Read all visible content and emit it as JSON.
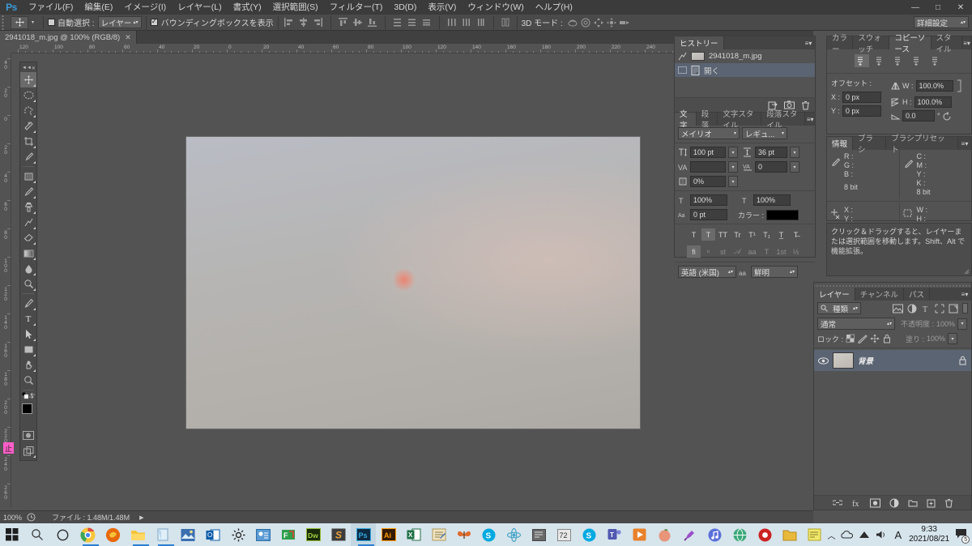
{
  "app": {
    "name": "Photoshop",
    "logo": "Ps"
  },
  "menubar": {
    "items": [
      {
        "label": "ファイル(F)"
      },
      {
        "label": "編集(E)"
      },
      {
        "label": "イメージ(I)"
      },
      {
        "label": "レイヤー(L)"
      },
      {
        "label": "書式(Y)"
      },
      {
        "label": "選択範囲(S)"
      },
      {
        "label": "フィルター(T)"
      },
      {
        "label": "3D(D)"
      },
      {
        "label": "表示(V)"
      },
      {
        "label": "ウィンドウ(W)"
      },
      {
        "label": "ヘルプ(H)"
      }
    ],
    "window_buttons": [
      "―",
      "□",
      "✕"
    ]
  },
  "options_bar": {
    "auto_select_label": "自動選択 :",
    "auto_select_checked": false,
    "layer_dropdown_value": "レイヤー",
    "bounding_box_label": "バウンディングボックスを表示",
    "bounding_box_checked": true,
    "mode_3d_label": "3D モード :",
    "workspace_value": "詳細設定"
  },
  "document": {
    "tab_title": "2941018_m.jpg @ 100% (RGB/8)",
    "close_glyph": "✕"
  },
  "rulers": {
    "h_ticks": [
      "120",
      "100",
      "80",
      "60",
      "40",
      "20",
      "0",
      "20",
      "40",
      "60",
      "80",
      "100",
      "120",
      "140",
      "160",
      "180",
      "200",
      "220",
      "240",
      "260",
      "280",
      "300",
      "320"
    ],
    "v_ticks": [
      "40",
      "20",
      "0",
      "20",
      "40",
      "60",
      "80",
      "100",
      "120",
      "140",
      "160",
      "180",
      "200",
      "220",
      "240",
      "260"
    ]
  },
  "toolbox": {
    "tools": [
      {
        "name": "move-tool",
        "glyph": "✥",
        "active": true
      },
      {
        "name": "elliptical-marquee-tool",
        "glyph": "◯"
      },
      {
        "name": "lasso-tool",
        "glyph": "🔗"
      },
      {
        "name": "magic-wand-tool",
        "glyph": "✦"
      },
      {
        "name": "crop-tool",
        "glyph": "⌗"
      },
      {
        "name": "eyedropper-tool",
        "glyph": "⚲"
      },
      {
        "name": "healing-brush-tool",
        "glyph": "▩"
      },
      {
        "name": "brush-tool",
        "glyph": "✎"
      },
      {
        "name": "clone-stamp-tool",
        "glyph": "⎙"
      },
      {
        "name": "history-brush-tool",
        "glyph": "⌁"
      },
      {
        "name": "eraser-tool",
        "glyph": "▭"
      },
      {
        "name": "gradient-tool",
        "glyph": "▤"
      },
      {
        "name": "blur-tool",
        "glyph": "💧"
      },
      {
        "name": "dodge-tool",
        "glyph": "◍"
      },
      {
        "name": "pen-tool",
        "glyph": "✒"
      },
      {
        "name": "type-tool",
        "glyph": "T"
      },
      {
        "name": "path-selection-tool",
        "glyph": "➤"
      },
      {
        "name": "rectangle-tool",
        "glyph": "▢"
      },
      {
        "name": "hand-tool",
        "glyph": "✋"
      },
      {
        "name": "zoom-tool",
        "glyph": "🔍"
      }
    ],
    "foreground_color": "#000000",
    "background_color": "#ffffff"
  },
  "history_panel": {
    "tabs": [
      {
        "label": "ヒストリー",
        "active": true
      }
    ],
    "rows": [
      {
        "label": "2941018_m.jpg",
        "type": "snapshot",
        "selected": false
      },
      {
        "label": "開く",
        "type": "state",
        "selected": true
      }
    ],
    "footer_icons": [
      "new-document-icon",
      "camera-icon",
      "trash-icon"
    ]
  },
  "character_panel": {
    "tabs": [
      {
        "label": "文字",
        "active": true
      },
      {
        "label": "段落",
        "active": false
      },
      {
        "label": "文字スタイル",
        "active": false
      },
      {
        "label": "段落スタイル",
        "active": false
      }
    ],
    "font_family": "メイリオ",
    "font_style": "レギュ...",
    "font_size": "100 pt",
    "leading": "36 pt",
    "tracking": "",
    "kerning": "0",
    "vertical_scale_pct": "100%",
    "horizontal_scale_pct": "100%",
    "baseline_shift": "0 pt",
    "t_scale_pct": "0%",
    "color_label": "カラー :",
    "color_value": "#000000",
    "style_buttons": [
      "T",
      "T",
      "TT",
      "Tr",
      "T¹",
      "T₁",
      "T̲",
      "T̶"
    ],
    "ot_buttons": [
      "fi",
      "ᵒ",
      "st",
      "𝒜",
      "aa",
      "T",
      "1st",
      "½"
    ],
    "language": "英語 (米国)",
    "antialias": "鮮明"
  },
  "clone_source_panel": {
    "tabs": [
      {
        "label": "カラー",
        "active": false
      },
      {
        "label": "スウォッチ",
        "active": false
      },
      {
        "label": "コピーソース",
        "active": true
      },
      {
        "label": "スタイル",
        "active": false
      }
    ],
    "offset_label": "オフセット :",
    "x_label": "X :",
    "x_value": "0 px",
    "y_label": "Y :",
    "y_value": "0 px",
    "w_label": "W :",
    "w_value": "100.0%",
    "h_label": "H :",
    "h_value": "100.0%",
    "angle_value": "0.0",
    "angle_unit": "°"
  },
  "info_panel": {
    "tabs": [
      {
        "label": "情報",
        "active": true
      },
      {
        "label": "ブラシ",
        "active": false
      },
      {
        "label": "ブラシプリセット",
        "active": false
      }
    ],
    "left_channels": [
      "R :",
      "G :",
      "B :"
    ],
    "left_depth": "8 bit",
    "right_channels": [
      "C :",
      "M :",
      "Y :",
      "K :"
    ],
    "right_depth": "8 bit",
    "coord_labels": [
      "X :",
      "Y :"
    ],
    "size_labels": [
      "W :",
      "H :"
    ],
    "file_label": "ファイル : 1.48M/1.48M",
    "hint_text": "クリック＆ドラッグすると、レイヤーまたは選択範囲を移動します。Shift、Alt で機能拡張。"
  },
  "layers_panel": {
    "tabs": [
      {
        "label": "レイヤー",
        "active": true
      },
      {
        "label": "チャンネル",
        "active": false
      },
      {
        "label": "パス",
        "active": false
      }
    ],
    "filter_label": "種類",
    "blend_mode": "通常",
    "opacity_label": "不透明度 :",
    "opacity_value": "100%",
    "lock_label": "ロック :",
    "fill_label": "塗り :",
    "fill_value": "100%",
    "layers": [
      {
        "name": "背景",
        "visible": true,
        "locked": true
      }
    ]
  },
  "status_bar": {
    "zoom": "100%",
    "file_info": "ファイル : 1.48M/1.48M",
    "arrow": "▶"
  },
  "taskbar": {
    "start_icon": "windows-start-icon",
    "search_icon": "search-icon",
    "cortana_icon": "cortana-icon",
    "apps": [
      {
        "name": "chrome-icon",
        "label": "C",
        "color": "#4285f4",
        "running": true
      },
      {
        "name": "firefox-icon",
        "label": "f",
        "color": "#e8690b",
        "running": false
      },
      {
        "name": "file-explorer-icon",
        "label": "📁",
        "color": "#f5c33b",
        "running": true
      },
      {
        "name": "notepad-icon",
        "label": "📘",
        "color": "#6ec2f0",
        "running": true
      },
      {
        "name": "photos-icon",
        "label": "🖼",
        "color": "#3a6fb0",
        "running": false
      },
      {
        "name": "outlook-icon",
        "label": "O",
        "color": "#0a5ba8",
        "running": false
      },
      {
        "name": "settings-gear-icon",
        "label": "⚙",
        "color": "#3b3b3b",
        "running": false
      },
      {
        "name": "contacts-icon",
        "label": "▤",
        "color": "#5b9bd5",
        "running": false
      },
      {
        "name": "ftp-icon",
        "label": "F",
        "color": "#2e9e4b",
        "running": false
      },
      {
        "name": "dreamweaver-icon",
        "label": "Dw",
        "color": "#6b8f1e",
        "running": false
      },
      {
        "name": "sublime-icon",
        "label": "S",
        "color": "#3d3d3d",
        "running": false
      },
      {
        "name": "photoshop-icon",
        "label": "Ps",
        "color": "#2b5d8a",
        "running": true,
        "current": true
      },
      {
        "name": "illustrator-icon",
        "label": "Ai",
        "color": "#d9802b",
        "running": false
      },
      {
        "name": "excel-icon",
        "label": "X",
        "color": "#1d7044",
        "running": false
      },
      {
        "name": "notes-icon",
        "label": "📝",
        "color": "#e8d8a8",
        "running": false
      },
      {
        "name": "butterfly-icon",
        "label": "🦋",
        "color": "#d8712a",
        "running": false
      },
      {
        "name": "skype-icon",
        "label": "S",
        "color": "#00a9e0",
        "running": false
      },
      {
        "name": "atom-icon",
        "label": "⚛",
        "color": "#4aa6c8",
        "running": false
      },
      {
        "name": "editor-icon",
        "label": "▤",
        "color": "#7a7a7a",
        "running": false
      },
      {
        "name": "calc-icon",
        "label": "72",
        "color": "#444",
        "running": false
      },
      {
        "name": "skype2-icon",
        "label": "S",
        "color": "#00a9e0",
        "running": false
      },
      {
        "name": "teams-icon",
        "label": "T",
        "color": "#5058b0",
        "running": false
      },
      {
        "name": "media-icon",
        "label": "▶",
        "color": "#e8822b",
        "running": false
      },
      {
        "name": "peach-icon",
        "label": "🍑",
        "color": "#e89a7a",
        "running": false
      },
      {
        "name": "paint3d-icon",
        "label": "✎",
        "color": "#9b4fc8",
        "running": false
      },
      {
        "name": "music-icon",
        "label": "♪",
        "color": "#5a6fd8",
        "running": false
      },
      {
        "name": "globe-icon",
        "label": "◉",
        "color": "#3aa87a",
        "running": false
      },
      {
        "name": "record-icon",
        "label": "●",
        "color": "#cc2222",
        "running": false
      },
      {
        "name": "folder-yellow-icon",
        "label": "📁",
        "color": "#e8b93a",
        "running": false
      },
      {
        "name": "sticky-notes-icon",
        "label": "▤",
        "color": "#e8d84a",
        "running": false
      }
    ],
    "tray": {
      "chevron": "︿",
      "icons": [
        "onedrive-icon",
        "network-icon",
        "volume-icon"
      ],
      "ime": "A",
      "time": "9:33",
      "date": "2021/08/21",
      "notification_count": "5"
    }
  },
  "colors": {
    "chrome_dark": "#535353",
    "panel_bg": "#535353",
    "accent_blue": "#3b9bd6",
    "selection": "#5b6472",
    "taskbar_bg": "#d6e4ec"
  }
}
